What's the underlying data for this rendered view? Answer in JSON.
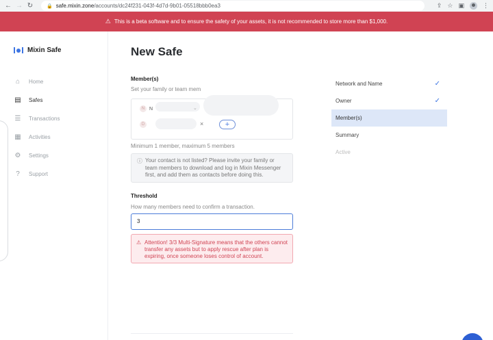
{
  "browser": {
    "url_host": "safe.mixin.zone",
    "url_path": "/accounts/dc24f231-043f-4d7d-9b01-05518bbb0ea3"
  },
  "banner": {
    "text": "This is a beta software and to ensure the safety of your assets, it is not recommended to store more than $1,000."
  },
  "sidebar": {
    "logo_text": "Mixin Safe",
    "items": [
      {
        "label": "Home",
        "icon": "home-icon"
      },
      {
        "label": "Safes",
        "icon": "safe-icon"
      },
      {
        "label": "Transactions",
        "icon": "transactions-icon"
      },
      {
        "label": "Activities",
        "icon": "activities-icon"
      },
      {
        "label": "Settings",
        "icon": "settings-icon"
      },
      {
        "label": "Support",
        "icon": "support-icon"
      }
    ],
    "active_index": 1
  },
  "main": {
    "title": "New Safe",
    "members": {
      "label": "Member(s)",
      "sublabel": "Set your family or team mem",
      "chip1_initial": "N",
      "chip1_name": "N",
      "chip2_initial": "D",
      "hint": "Minimum 1 member, maximum 5 members",
      "info": "Your contact is not listed? Please invite your family or team members to download and log in Mixin Messenger first, and add them as contacts before doing this."
    },
    "threshold": {
      "label": "Threshold",
      "sublabel": "How many members need to confirm a transaction.",
      "value": "3",
      "alert": "Attention! 3/3 Multi-Signature means that the others cannot transfer any assets but to apply rescue after plan is expiring, once someone loses control of account."
    }
  },
  "steps": [
    {
      "label": "Network and Name",
      "state": "done"
    },
    {
      "label": "Owner",
      "state": "done"
    },
    {
      "label": "Member(s)",
      "state": "current"
    },
    {
      "label": "Summary",
      "state": "pending"
    },
    {
      "label": "Active",
      "state": "disabled"
    }
  ],
  "colors": {
    "banner": "#d04353",
    "accent": "#3d75e3",
    "step_current_bg": "#dde7f8"
  }
}
